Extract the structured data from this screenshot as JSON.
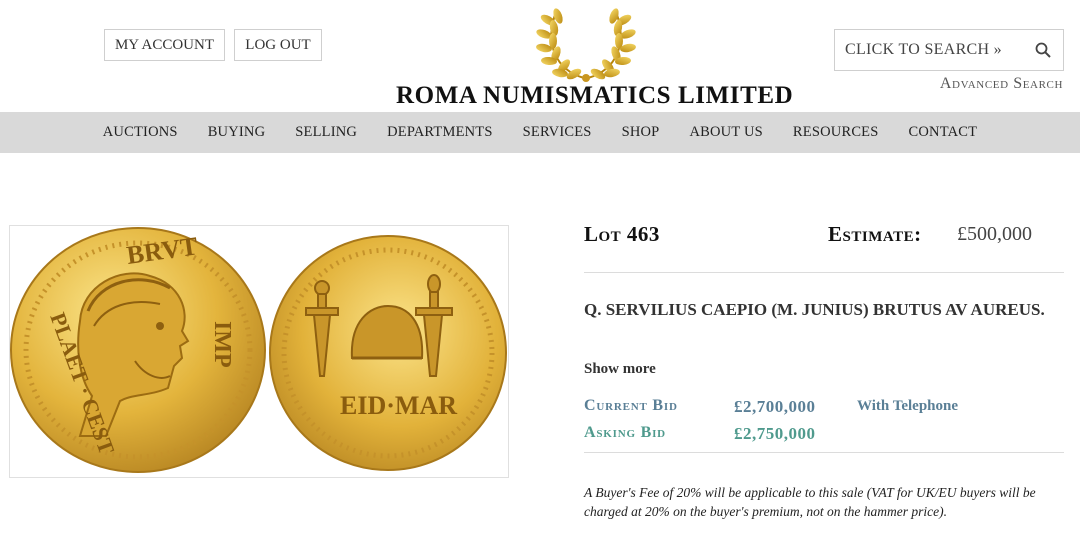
{
  "header": {
    "my_account_label": "MY ACCOUNT",
    "log_out_label": "LOG OUT",
    "logo_text": "ROMA NUMISMATICS LIMITED",
    "search_label": "CLICK TO SEARCH »",
    "advanced_search_label": "Advanced Search"
  },
  "nav": {
    "items": [
      "AUCTIONS",
      "BUYING",
      "SELLING",
      "DEPARTMENTS",
      "SERVICES",
      "SHOP",
      "ABOUT US",
      "RESOURCES",
      "CONTACT"
    ]
  },
  "coin": {
    "obverse_legend_top": "BRVT",
    "obverse_legend_left": "PLAET · CEST",
    "obverse_legend_right": "IMP",
    "reverse_legend": "EID·MAR"
  },
  "lot": {
    "title": "Lot 463",
    "estimate_label": "Estimate:",
    "estimate_value": "£500,000",
    "name": "Q. SERVILIUS CAEPIO (M. JUNIUS) BRUTUS AV AUREUS.",
    "show_more": "Show more",
    "current_bid_label": "Current Bid",
    "current_bid_value": "£2,700,000",
    "with_label": "With Telephone",
    "asking_bid_label": "Asking Bid",
    "asking_bid_value": "£2,750,000",
    "fee_note": "A Buyer's Fee of 20% will be applicable to this sale (VAT for UK/EU buyers will be charged at 20% on the buyer's premium, not on the hammer price)."
  },
  "colors": {
    "nav_bg": "#d9d9d9",
    "current_bid": "#5a7f96",
    "asking_bid": "#4f9a8d",
    "gold": "#e0b23a"
  }
}
